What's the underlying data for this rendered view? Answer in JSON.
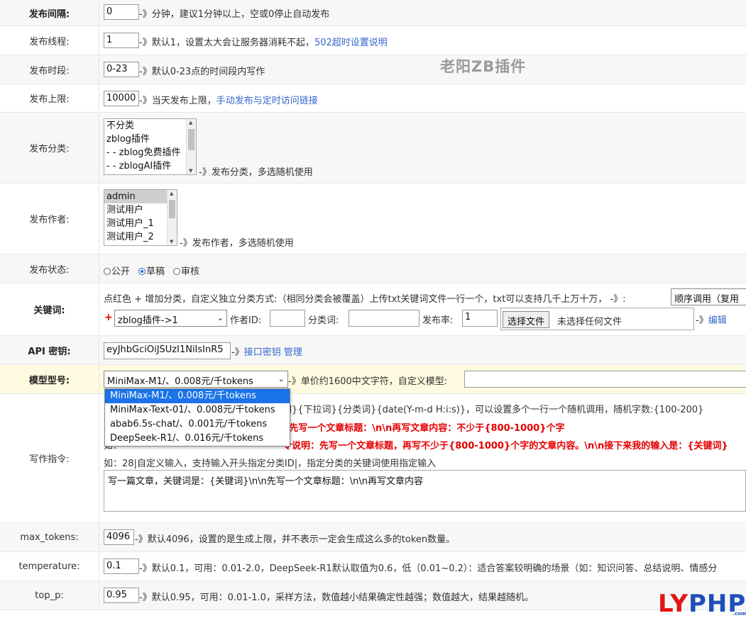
{
  "rows": {
    "interval": {
      "label": "发布间隔:",
      "value": "0",
      "hint": "-》分钟，建议1分钟以上，空或0停止自动发布"
    },
    "threads": {
      "label": "发布线程:",
      "value": "1",
      "hint": "-》默认1，设置太大会让服务器消耗不起，",
      "link": "502超时设置说明"
    },
    "period": {
      "label": "发布时段:",
      "value": "0-23",
      "hint": "-》默认0-23点的时间段内写作"
    },
    "limit": {
      "label": "发布上限:",
      "value": "10000",
      "hint": "-》当天发布上限，",
      "link": "手动发布与定时访问链接"
    },
    "category": {
      "label": "发布分类:",
      "options": [
        "不分类",
        "zblog插件",
        "- - zblog免费插件",
        "- - zblogAI插件"
      ],
      "hint": "-》发布分类，多选随机使用"
    },
    "author": {
      "label": "发布作者:",
      "options": [
        "admin",
        "测试用户",
        "测试用户_1",
        "测试用户_2"
      ],
      "hint": "-》发布作者，多选随机使用"
    },
    "status": {
      "label": "发布状态:",
      "options": [
        "公开",
        "草稿",
        "审核"
      ],
      "selected": "草稿"
    },
    "keywords": {
      "label": "关键词:",
      "desc": "点红色 + 增加分类，自定义独立分类方式:（相同分类会被覆盖）上传txt关键词文件一行一个，txt可以支持几千上万十万， -》:",
      "order_select": "顺序调用（复用",
      "plus": "+",
      "cat_select": "zblog插件->1",
      "author_id_label": "作者ID:",
      "author_id_value": "",
      "cat_word_label": "分类词:",
      "cat_word_value": "",
      "rate_label": "发布率:",
      "rate_value": "1",
      "file_button": "选择文件",
      "file_status": "未选择任何文件",
      "edit_arrow": "-》",
      "edit_link": "编辑"
    },
    "api_key": {
      "label": "API 密钥:",
      "value": "eyJhbGciOiJSUzI1NiIsInR5",
      "hint": "-》",
      "link": "接口密钥 管理"
    },
    "model": {
      "label": "模型型号:",
      "selected": "MiniMax-M1/、0.008元/千tokens",
      "hint": "-》单价约1600中文字符，自定义模型:",
      "custom_value": "",
      "options": [
        "MiniMax-M1/、0.008元/千tokens",
        "MiniMax-Text-01/、0.008元/千tokens",
        "abab6.5s-chat/、0.001元/千tokens",
        "DeepSeek-R1/、0.016元/千tokens"
      ]
    },
    "prompt": {
      "label": "写作指令:",
      "line1": "词}{下拉词}{分类词}{date(Y-m-d H:i:s)}，可以设置多个一行一个随机调用，随机字数:{100-200}",
      "line2": "n先写一个文章标题：\\n\\n再写文章内容：不少于{800-1000}个字",
      "line3a": "如：",
      "line3b": "令说明：先写一个文章标题，再写不少于{800-1000}个字的文章内容。\\n\\n接下来我的输入是：{关键词}",
      "line4": "如：28|自定义输入，支持输入开头指定分类ID|，指定分类的关键词使用指定输入",
      "textarea": "写一篇文章，关键词是：{关键词}\\n\\n先写一个文章标题：\\n\\n再写文章内容"
    },
    "max_tokens": {
      "label": "max_tokens:",
      "value": "4096",
      "hint": "-》默认4096，设置的是生成上限，并不表示一定会生成这么多的token数量。"
    },
    "temperature": {
      "label": "temperature:",
      "value": "0.1",
      "hint": "-》默认0.1，可用：0.01-2.0，DeepSeek-R1默认取值为0.6，低（0.01~0.2）：适合答案较明确的场景（如：知识问答、总结说明、情感分"
    },
    "top_p": {
      "label": "top_p:",
      "value": "0.95",
      "hint": "-》默认0.95，可用：0.01-1.0，采样方法，数值越小结果确定性越强；数值越大，结果越随机。"
    }
  },
  "watermark": "老阳ZB插件",
  "logo": {
    "ly": "LY",
    "php": "PHP",
    "com": ".com"
  }
}
